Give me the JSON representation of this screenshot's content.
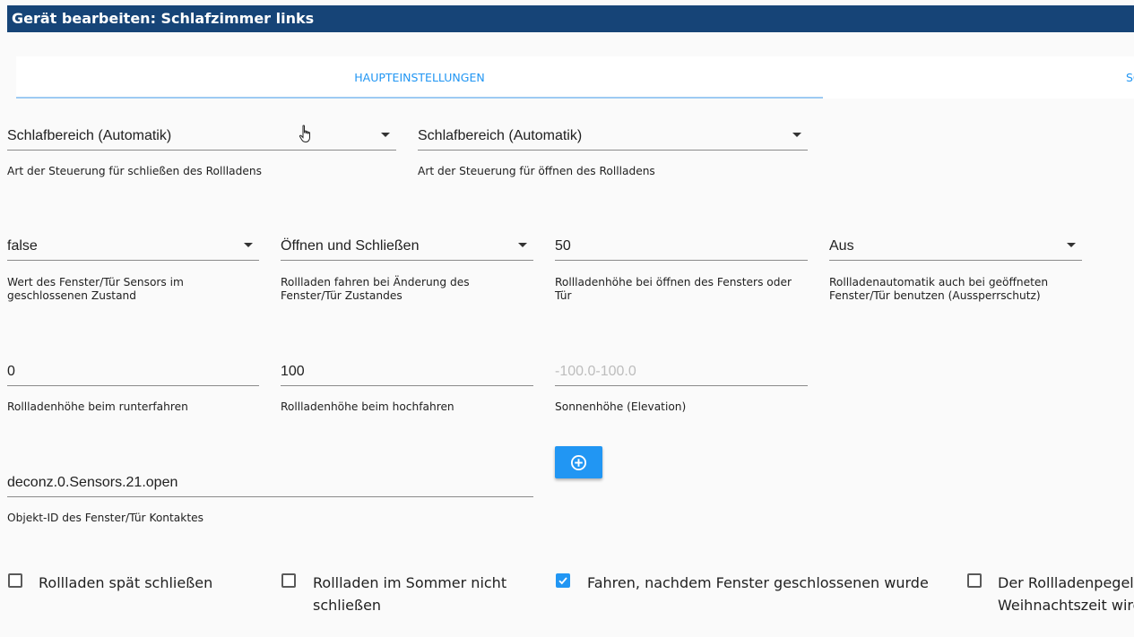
{
  "window": {
    "title": "Gerät bearbeiten: Schlafzimmer links"
  },
  "tabs": [
    {
      "label": "HAUPTEINSTELLUNGEN",
      "active": true
    },
    {
      "label": "SO"
    }
  ],
  "fields": {
    "close_type": {
      "value": "Schlafbereich (Automatik)",
      "help": "Art der Steuerung für schließen des Rollladens"
    },
    "open_type": {
      "value": "Schlafbereich (Automatik)",
      "help": "Art der Steuerung für öffnen des Rollladens"
    },
    "sensor_closed_value": {
      "value": "false",
      "help_lines": [
        "Wert des Fenster/Tür Sensors im",
        "geschlossenen Zustand"
      ]
    },
    "move_on_change": {
      "value": "Öffnen und Schließen",
      "help_lines": [
        "Rollladen fahren bei Änderung des",
        "Fenster/Tür Zustandes"
      ]
    },
    "height_on_open": {
      "value": "50",
      "help_lines": [
        "Rollladenhöhe bei öffnen des Fensters oder",
        "Tür"
      ]
    },
    "lockout_protection": {
      "value": "Aus",
      "help_lines": [
        "Rollladenautomatik auch bei geöffneten",
        "Fenster/Tür benutzen (Aussperrschutz)"
      ]
    },
    "height_down": {
      "value": "0",
      "help": "Rollladenhöhe beim runterfahren"
    },
    "height_up": {
      "value": "100",
      "help": "Rollladenhöhe beim hochfahren"
    },
    "elevation": {
      "placeholder": "-100.0-100.0",
      "help": "Sonnenhöhe (Elevation)"
    },
    "contact_id": {
      "value": "deconz.0.Sensors.21.open",
      "help": "Objekt-ID des Fenster/Tür Kontaktes"
    }
  },
  "add_button": {
    "icon": "plus-circle-icon"
  },
  "checkboxes": [
    {
      "lines": [
        "Rollladen spät schließen"
      ],
      "checked": false
    },
    {
      "lines": [
        "Rollladen im Sommer nicht",
        "schließen"
      ],
      "checked": false
    },
    {
      "lines": [
        "Fahren, nachdem Fenster geschlossenen wurde"
      ],
      "checked": true
    },
    {
      "lines": [
        "Der Rollladenpegel",
        "Weihnachtszeit wird"
      ],
      "checked": false
    }
  ],
  "colors": {
    "titlebar": "#164477",
    "accent": "#2196f3",
    "tab_indicator": "#9ecbf3"
  }
}
